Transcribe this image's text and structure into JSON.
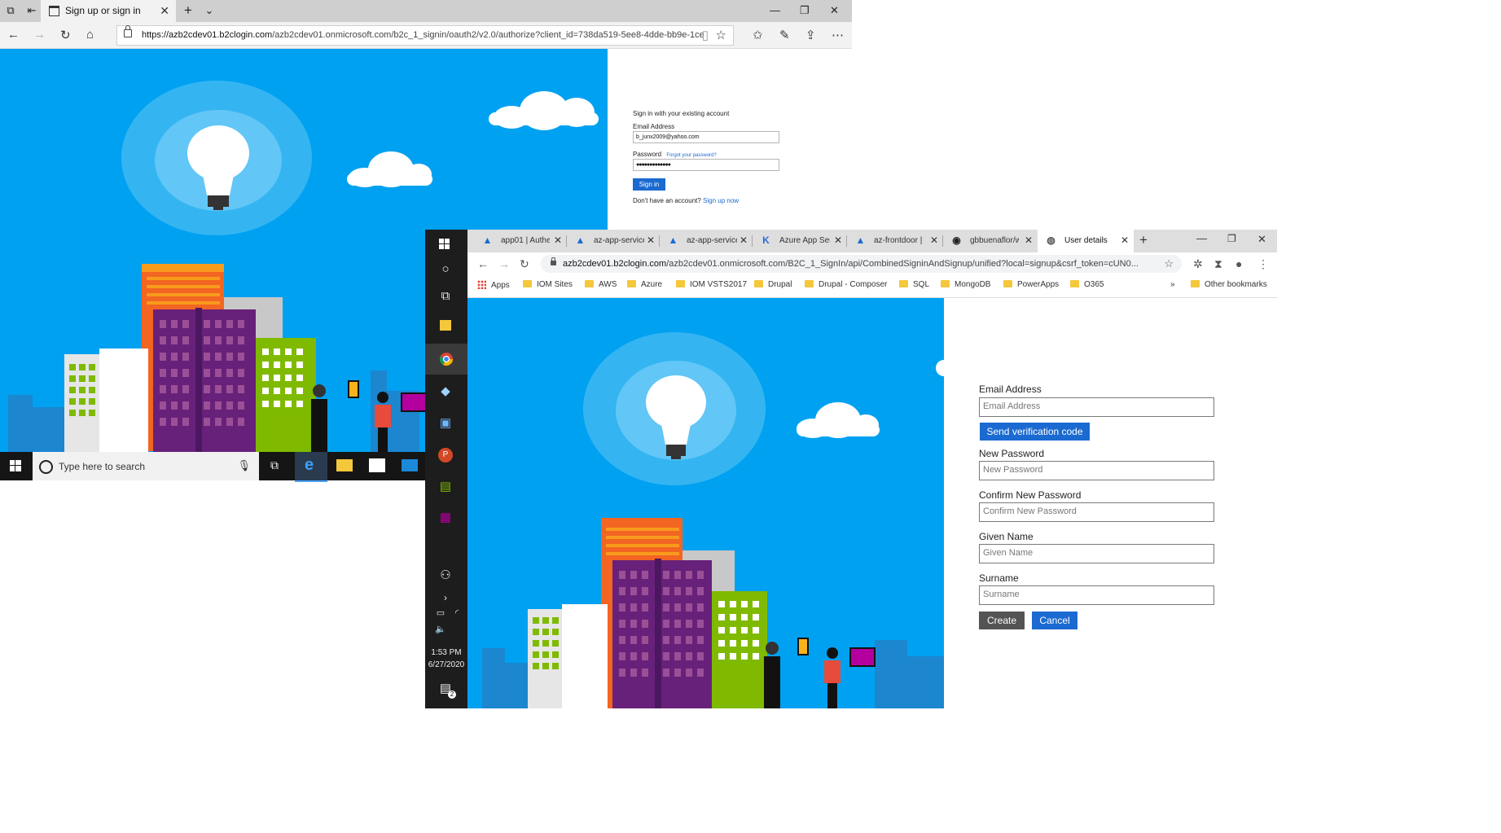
{
  "edge": {
    "tab_title": "Sign up or sign in",
    "url_host": "https://azb2cdev01.b2clogin.com",
    "url_path": "/azb2cdev01.onmicrosoft.com/b2c_1_signin/oauth2/v2.0/authorize?client_id=738da519-5ee8-4dde-bb9e-1ce",
    "form": {
      "heading": "Sign in with your existing account",
      "email_label": "Email Address",
      "email_value": "b_junx2009@yahoo.com",
      "password_label": "Password",
      "forgot_link": "Forgot your password?",
      "password_value": "●●●●●●●●●●●●●",
      "signin_button": "Sign in",
      "no_account_text": "Don't have an account?",
      "signup_link": "Sign up now"
    },
    "taskbar": {
      "search_placeholder": "Type here to search"
    }
  },
  "chrome": {
    "tabs": [
      {
        "label": "app01 | Authe",
        "icon": "azure-icon"
      },
      {
        "label": "az-app-service",
        "icon": "azure-icon"
      },
      {
        "label": "az-app-service",
        "icon": "azure-icon"
      },
      {
        "label": "Azure App Ser",
        "icon": "kudu-icon"
      },
      {
        "label": "az-frontdoor |",
        "icon": "azure-icon"
      },
      {
        "label": "gbbuenaflor/w",
        "icon": "github-icon"
      },
      {
        "label": "User details",
        "icon": "globe-icon"
      }
    ],
    "url_host": "azb2cdev01.b2clogin.com",
    "url_path": "/azb2cdev01.onmicrosoft.com/B2C_1_SignIn/api/CombinedSigninAndSignup/unified?local=signup&csrf_token=cUN0...",
    "bookmarks": [
      "Apps",
      "IOM Sites",
      "AWS",
      "Azure",
      "IOM VSTS2017",
      "Drupal",
      "Drupal - Composer",
      "SQL",
      "MongoDB",
      "PowerApps",
      "O365"
    ],
    "bookmarks_overflow": "»",
    "other_bookmarks": "Other bookmarks",
    "form": {
      "email_label": "Email Address",
      "email_placeholder": "Email Address",
      "send_code_button": "Send verification code",
      "new_password_label": "New Password",
      "new_password_placeholder": "New Password",
      "confirm_password_label": "Confirm New Password",
      "confirm_password_placeholder": "Confirm New Password",
      "given_name_label": "Given Name",
      "given_name_placeholder": "Given Name",
      "surname_label": "Surname",
      "surname_placeholder": "Surname",
      "create_button": "Create",
      "cancel_button": "Cancel"
    },
    "clock": {
      "time": "1:53 PM",
      "date": "6/27/2020"
    },
    "notification_count": "2"
  },
  "colors": {
    "sky": "#00a1f1",
    "accent_blue": "#1b6ad1",
    "taskbar": "#151515"
  }
}
